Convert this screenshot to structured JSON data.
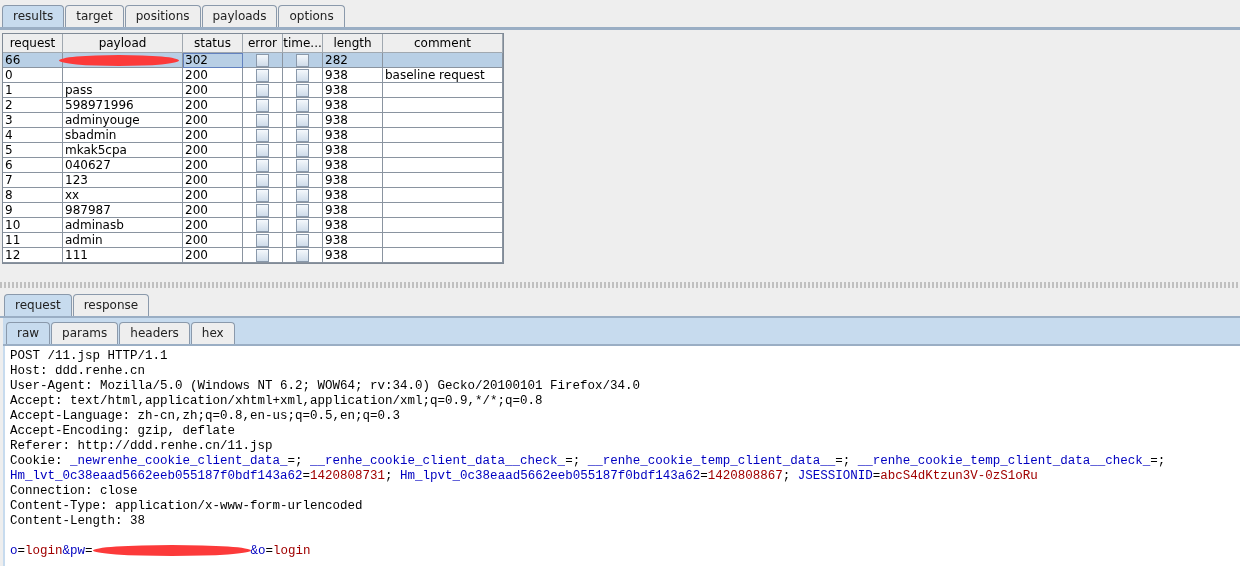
{
  "tabs": [
    {
      "label": "results",
      "selected": true
    },
    {
      "label": "target",
      "selected": false
    },
    {
      "label": "positions",
      "selected": false
    },
    {
      "label": "payloads",
      "selected": false
    },
    {
      "label": "options",
      "selected": false
    }
  ],
  "table": {
    "columns": [
      "request",
      "payload",
      "status",
      "error",
      "time...",
      "length",
      "comment"
    ],
    "rows": [
      {
        "request": "66",
        "redacted": true,
        "status": "302",
        "error": false,
        "timeout": false,
        "length": "282",
        "selected": true
      },
      {
        "request": "0",
        "redacted": false,
        "status": "200",
        "error": false,
        "timeout": false,
        "length": "938",
        "comment": "baseline request",
        "selected": false
      },
      {
        "request": "1",
        "payload": "pass",
        "redacted": false,
        "status": "200",
        "error": false,
        "timeout": false,
        "length": "938",
        "selected": false
      },
      {
        "request": "2",
        "payload": "598971996",
        "redacted": false,
        "status": "200",
        "error": false,
        "timeout": false,
        "length": "938",
        "selected": false
      },
      {
        "request": "3",
        "payload": "adminyouge",
        "redacted": false,
        "status": "200",
        "error": false,
        "timeout": false,
        "length": "938",
        "selected": false
      },
      {
        "request": "4",
        "payload": "sbadmin",
        "redacted": false,
        "status": "200",
        "error": false,
        "timeout": false,
        "length": "938",
        "selected": false
      },
      {
        "request": "5",
        "payload": "mkak5cpa",
        "redacted": false,
        "status": "200",
        "error": false,
        "timeout": false,
        "length": "938",
        "selected": false
      },
      {
        "request": "6",
        "payload": "040627",
        "redacted": false,
        "status": "200",
        "error": false,
        "timeout": false,
        "length": "938",
        "selected": false
      },
      {
        "request": "7",
        "payload": "123",
        "redacted": false,
        "status": "200",
        "error": false,
        "timeout": false,
        "length": "938",
        "selected": false
      },
      {
        "request": "8",
        "payload": "xx",
        "redacted": false,
        "status": "200",
        "error": false,
        "timeout": false,
        "length": "938",
        "selected": false
      },
      {
        "request": "9",
        "payload": "987987",
        "redacted": false,
        "status": "200",
        "error": false,
        "timeout": false,
        "length": "938",
        "selected": false
      },
      {
        "request": "10",
        "payload": "adminasb",
        "redacted": false,
        "status": "200",
        "error": false,
        "timeout": false,
        "length": "938",
        "selected": false
      },
      {
        "request": "11",
        "payload": "admin",
        "redacted": false,
        "status": "200",
        "error": false,
        "timeout": false,
        "length": "938",
        "selected": false
      },
      {
        "request": "12",
        "payload": "111",
        "redacted": false,
        "status": "200",
        "error": false,
        "timeout": false,
        "length": "938",
        "selected": false
      }
    ]
  },
  "message_tabs": [
    {
      "label": "request",
      "selected": true
    },
    {
      "label": "response",
      "selected": false
    }
  ],
  "view_tabs": [
    {
      "label": "raw",
      "selected": true
    },
    {
      "label": "params",
      "selected": false
    },
    {
      "label": "headers",
      "selected": false
    },
    {
      "label": "hex",
      "selected": false
    }
  ],
  "raw_lines": [
    [
      {
        "kind": "plain",
        "text": "POST /11.jsp HTTP/1.1"
      }
    ],
    [
      {
        "kind": "plain",
        "text": "Host: ddd.renhe.cn"
      }
    ],
    [
      {
        "kind": "plain",
        "text": "User-Agent: Mozilla/5.0 (Windows NT 6.2; WOW64; rv:34.0) Gecko/20100101 Firefox/34.0"
      }
    ],
    [
      {
        "kind": "plain",
        "text": "Accept: text/html,application/xhtml+xml,application/xml;q=0.9,*/*;q=0.8"
      }
    ],
    [
      {
        "kind": "plain",
        "text": "Accept-Language: zh-cn,zh;q=0.8,en-us;q=0.5,en;q=0.3"
      }
    ],
    [
      {
        "kind": "plain",
        "text": "Accept-Encoding: gzip, deflate"
      }
    ],
    [
      {
        "kind": "plain",
        "text": "Referer: http://ddd.renhe.cn/11.jsp"
      }
    ],
    [
      {
        "kind": "plain",
        "text": "Cookie: "
      },
      {
        "kind": "name",
        "text": "_newrenhe_cookie_client_data_"
      },
      {
        "kind": "plain",
        "text": "=; "
      },
      {
        "kind": "name",
        "text": "__renhe_cookie_client_data__check_"
      },
      {
        "kind": "plain",
        "text": "=; "
      },
      {
        "kind": "name",
        "text": "__renhe_cookie_temp_client_data__"
      },
      {
        "kind": "plain",
        "text": "=; "
      },
      {
        "kind": "name",
        "text": "__renhe_cookie_temp_client_data__check_"
      },
      {
        "kind": "plain",
        "text": "=;"
      }
    ],
    [
      {
        "kind": "name",
        "text": "Hm_lvt_0c38eaad5662eeb055187f0bdf143a62"
      },
      {
        "kind": "plain",
        "text": "="
      },
      {
        "kind": "value",
        "text": "1420808731"
      },
      {
        "kind": "plain",
        "text": "; "
      },
      {
        "kind": "name",
        "text": "Hm_lpvt_0c38eaad5662eeb055187f0bdf143a62"
      },
      {
        "kind": "plain",
        "text": "="
      },
      {
        "kind": "value",
        "text": "1420808867"
      },
      {
        "kind": "plain",
        "text": "; "
      },
      {
        "kind": "name",
        "text": "JSESSIONID"
      },
      {
        "kind": "plain",
        "text": "="
      },
      {
        "kind": "value",
        "text": "abcS4dKtzun3V-0zS1oRu"
      }
    ],
    [
      {
        "kind": "plain",
        "text": "Connection: close"
      }
    ],
    [
      {
        "kind": "plain",
        "text": "Content-Type: application/x-www-form-urlencoded"
      }
    ],
    [
      {
        "kind": "plain",
        "text": "Content-Length: 38"
      }
    ],
    [
      {
        "kind": "blank"
      }
    ],
    [
      {
        "kind": "name",
        "text": "o"
      },
      {
        "kind": "plain",
        "text": "="
      },
      {
        "kind": "value",
        "text": "login"
      },
      {
        "kind": "name",
        "text": "&pw"
      },
      {
        "kind": "plain",
        "text": "="
      },
      {
        "kind": "redacted"
      },
      {
        "kind": "name",
        "text": "&o"
      },
      {
        "kind": "plain",
        "text": "="
      },
      {
        "kind": "value",
        "text": "login"
      }
    ]
  ]
}
